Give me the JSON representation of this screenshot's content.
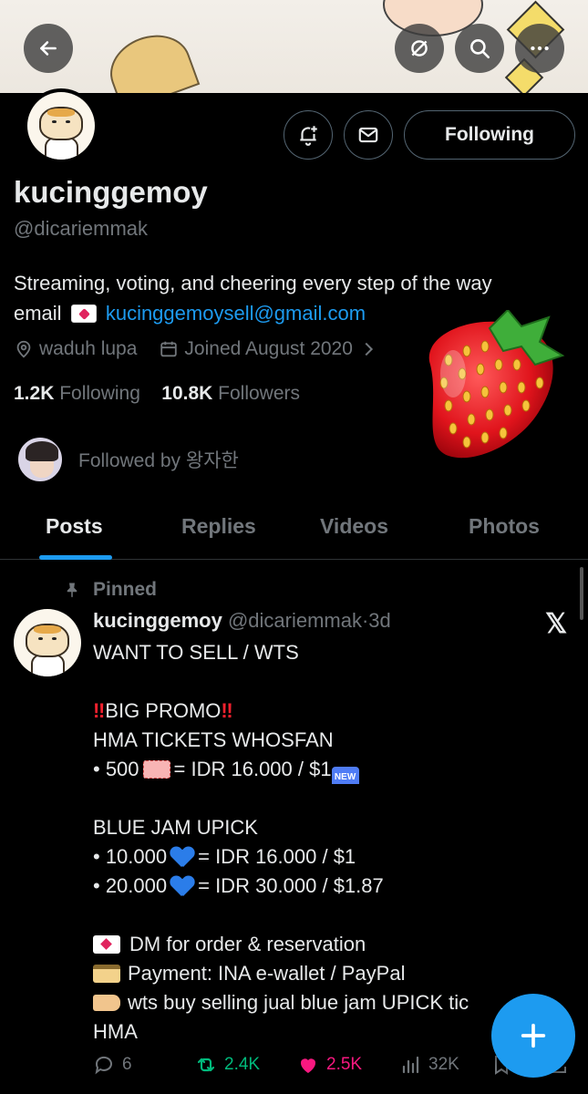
{
  "profile": {
    "name": "kucinggemoy",
    "handle": "@dicariemmak",
    "bio_line1": "Streaming, voting, and cheering every step of the way",
    "bio_email_prefix": "email",
    "bio_email": "kucinggemoysell@gmail.com",
    "location": "waduh lupa",
    "joined": "Joined August 2020",
    "following_count": "1.2K",
    "following_label": "Following",
    "followers_count": "10.8K",
    "followers_label": "Followers",
    "followed_by": "Followed by 왕자한",
    "following_button": "Following"
  },
  "header": {
    "back_icon": "arrow-left-icon",
    "hide_icon": "eye-slash-icon",
    "search_icon": "search-icon",
    "more_icon": "more-icon"
  },
  "tabs": [
    {
      "label": "Posts"
    },
    {
      "label": "Replies"
    },
    {
      "label": "Videos"
    },
    {
      "label": "Photos"
    }
  ],
  "post": {
    "pinned_label": "Pinned",
    "author_name": "kucinggemoy",
    "author_handle": "@dicariemmak",
    "dot": "·",
    "time": "3d",
    "lines": {
      "l1": "WANT TO SELL / WTS",
      "l2": "BIG PROMO",
      "l3": "HMA TICKETS WHOSFAN",
      "l4a": "• 500",
      "l4b": "= IDR 16.000 / $1",
      "l4c": "NEW",
      "l5": "BLUE JAM UPICK",
      "l6a": "• 10.000",
      "l6b": "= IDR 16.000 / $1",
      "l7a": "• 20.000",
      "l7b": "= IDR 30.000 / $1.87",
      "l8": "DM for order & reservation",
      "l9": "Payment: INA e-wallet / PayPal",
      "l10": "wts buy selling jual blue jam UPICK tic",
      "l11": "HMA"
    },
    "replies": "6",
    "reposts": "2.4K",
    "likes": "2.5K",
    "views": "32K"
  },
  "colors": {
    "accent": "#1d9bf0",
    "repost": "#00ba7c",
    "like": "#f91880"
  }
}
